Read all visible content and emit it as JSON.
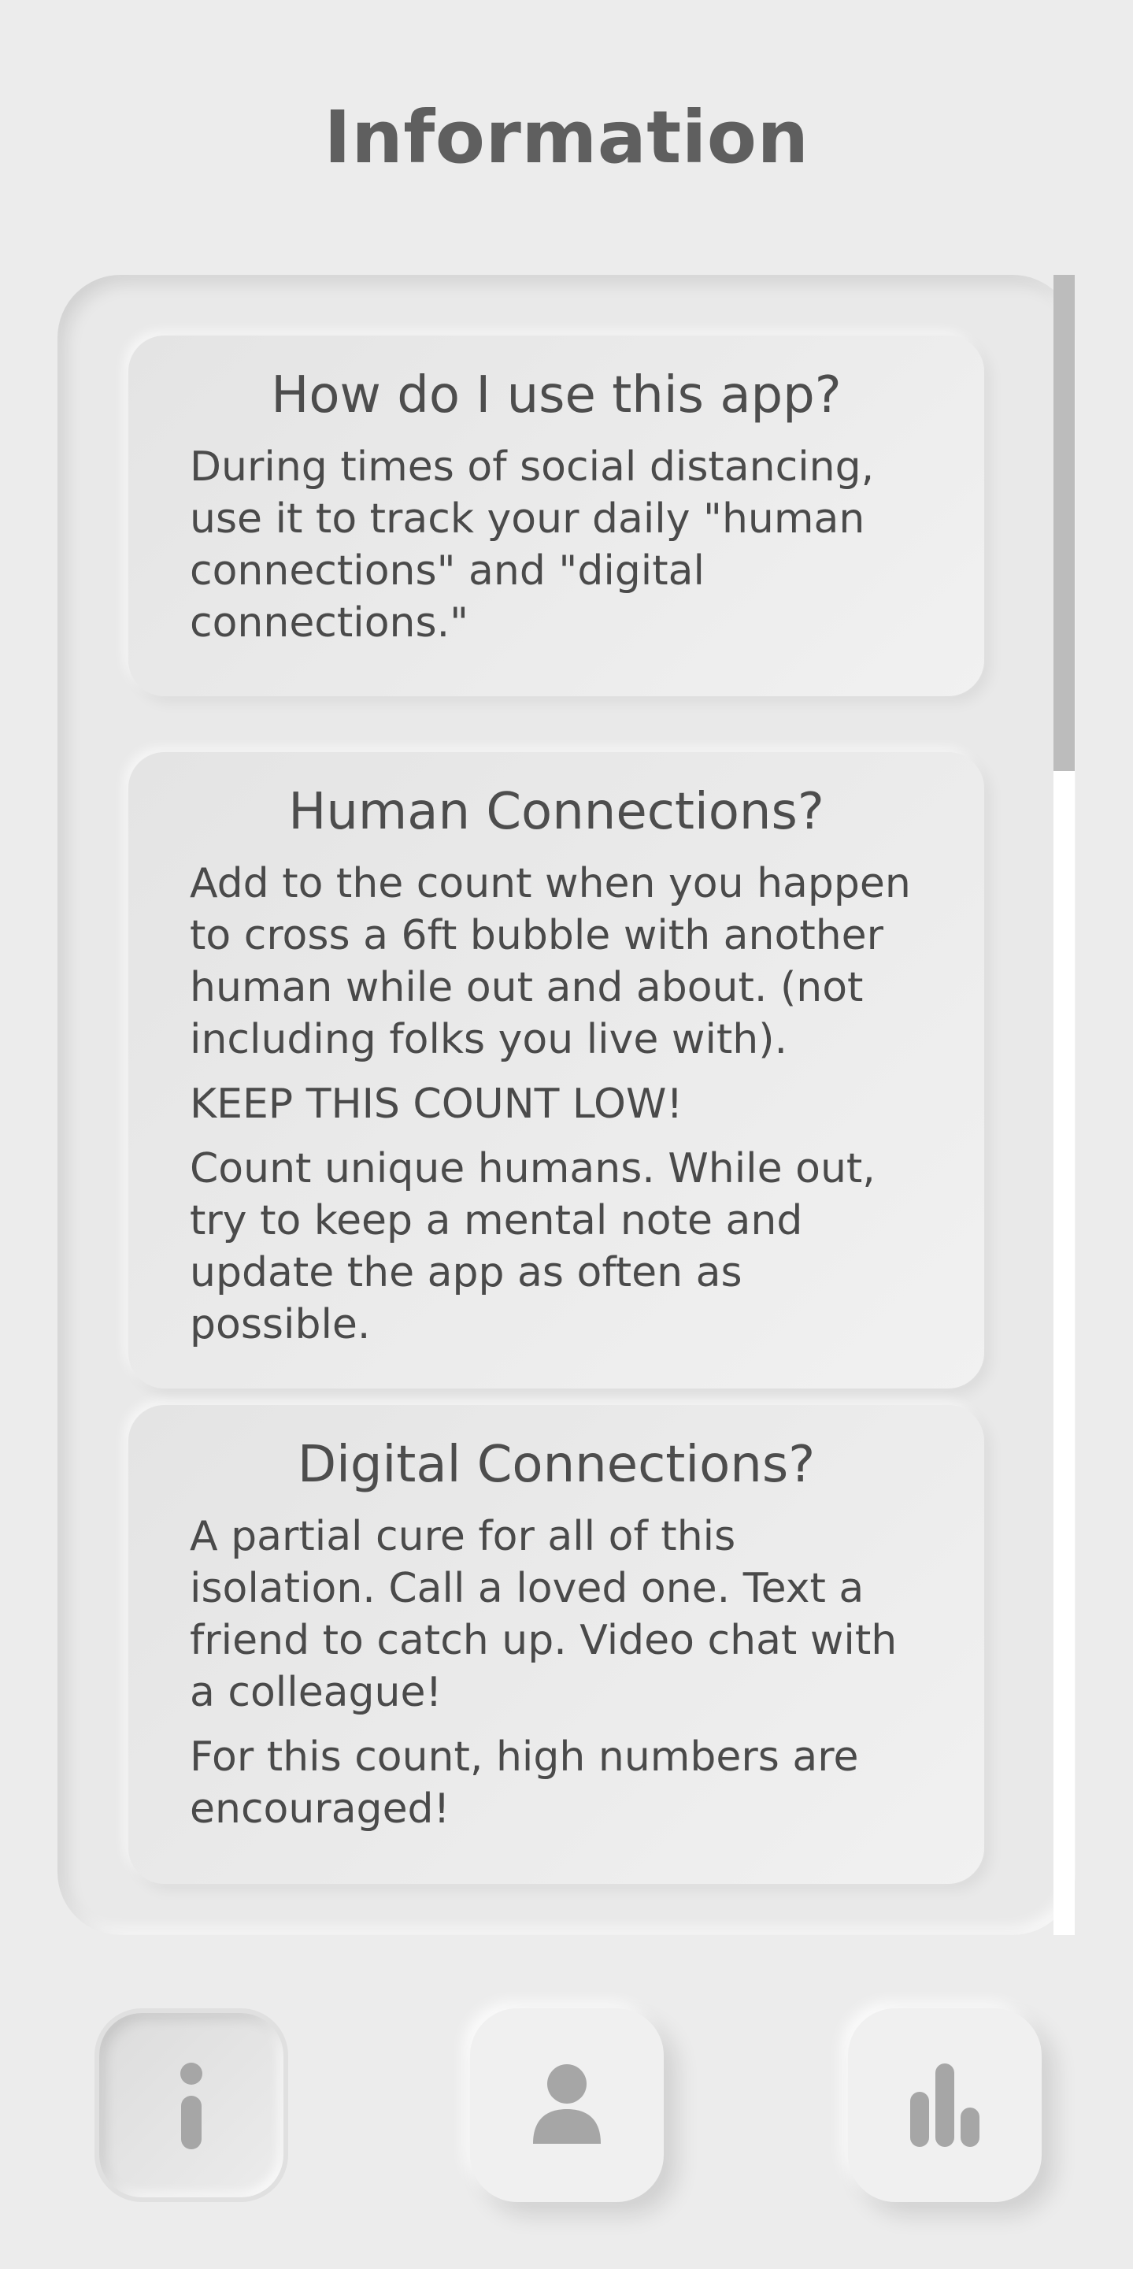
{
  "header": {
    "title": "Information"
  },
  "cards": [
    {
      "heading": "How do I use this app?",
      "paragraphs": [
        "During times of social distancing, use it to track your daily \"human connections\" and \"digital connections.\""
      ]
    },
    {
      "heading": "Human Connections?",
      "paragraphs": [
        "Add to the count when you happen to cross a 6ft bubble with another human while out and about. (not including folks you live with).",
        "KEEP THIS COUNT LOW!",
        "Count unique humans. While out, try to keep a mental note and update the app as often as possible."
      ]
    },
    {
      "heading": "Digital Connections?",
      "paragraphs": [
        "A partial cure for all of this isolation. Call a loved one. Text a friend to catch up. Video chat with a colleague!",
        "For this count, high numbers are encouraged!"
      ]
    }
  ],
  "nav": {
    "items": [
      {
        "icon": "info-icon",
        "active": true
      },
      {
        "icon": "person-icon",
        "active": false
      },
      {
        "icon": "bar-chart-icon",
        "active": false
      }
    ]
  },
  "colors": {
    "background": "#ececec",
    "icon": "#a6a6a6",
    "scrollbar_thumb": "#bcbcbc"
  }
}
